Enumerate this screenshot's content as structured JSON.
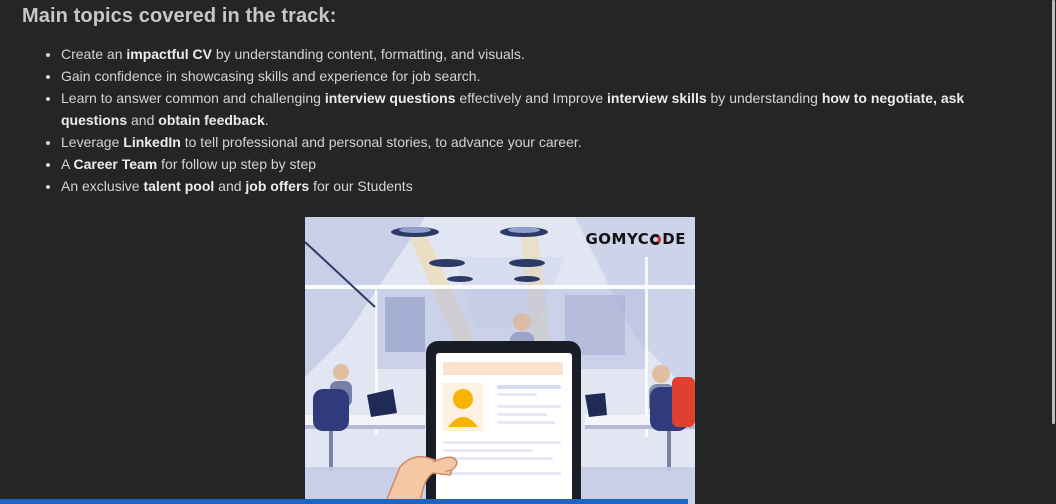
{
  "heading": "Main topics covered in the track:",
  "topics": [
    [
      {
        "t": "Create an "
      },
      {
        "t": "impactful CV",
        "b": true
      },
      {
        "t": " by understanding content, formatting, and visuals."
      }
    ],
    [
      {
        "t": "Gain confidence in showcasing skills and experience for job search."
      }
    ],
    [
      {
        "t": "Learn to answer common and challenging "
      },
      {
        "t": "interview questions",
        "b": true
      },
      {
        "t": " effectively and Improve "
      },
      {
        "t": "interview skills",
        "b": true
      },
      {
        "t": " by understanding "
      },
      {
        "t": "how to negotiate, ask questions",
        "b": true
      },
      {
        "t": " and "
      },
      {
        "t": "obtain feedback",
        "b": true
      },
      {
        "t": "."
      }
    ],
    [
      {
        "t": "Leverage "
      },
      {
        "t": "LinkedIn",
        "b": true
      },
      {
        "t": " to tell professional and personal stories, to advance your career."
      }
    ],
    [
      {
        "t": "A "
      },
      {
        "t": "Career Team",
        "b": true
      },
      {
        "t": " for follow up step by step"
      }
    ],
    [
      {
        "t": "An exclusive "
      },
      {
        "t": "talent pool",
        "b": true
      },
      {
        "t": " and "
      },
      {
        "t": "job offers",
        "b": true
      },
      {
        "t": " for our Students"
      }
    ]
  ],
  "banner": {
    "brand_prefix": "GOMYC",
    "brand_suffix": "DE",
    "brand_accent": "#e0252b",
    "illustration": "office-with-tablet-cv-illustration"
  },
  "colors": {
    "background": "#242526",
    "text": "#d4d4d4",
    "accent_bar": "#1f64c3"
  }
}
